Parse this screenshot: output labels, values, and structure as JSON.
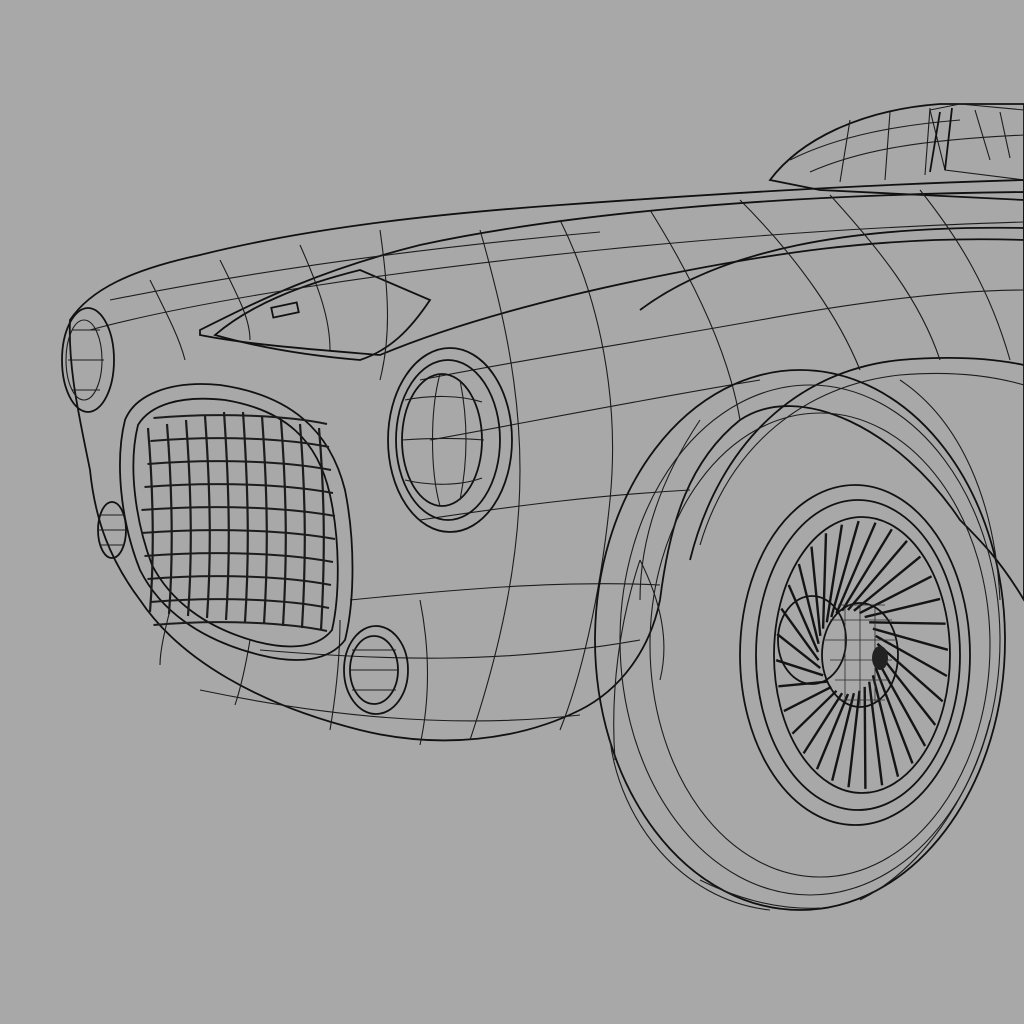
{
  "scene": {
    "background_color": "#a8a8a8",
    "surface_color": "#d9d9d9",
    "shadow_color": "#9c9c9c",
    "wire_color": "#1c1c1c",
    "spoke_color": "#141414",
    "wheel_spoke_count": 32
  }
}
